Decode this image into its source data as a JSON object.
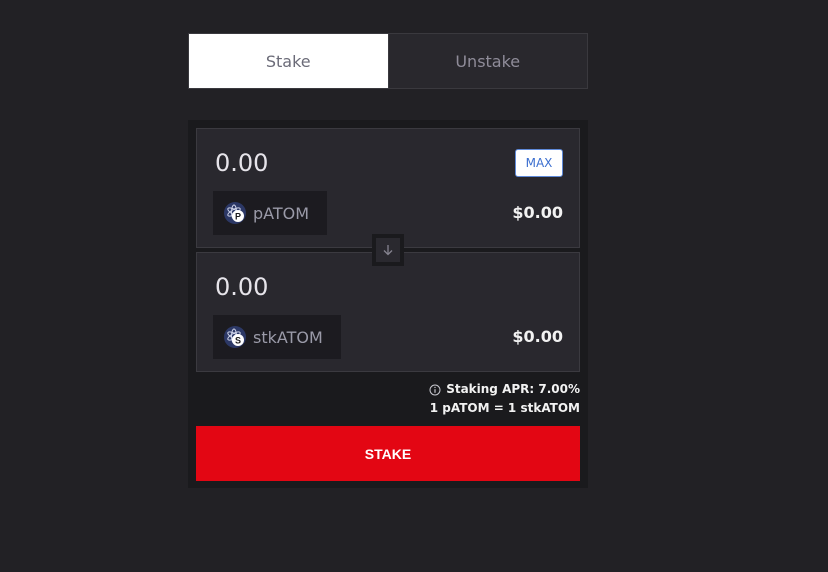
{
  "tabs": {
    "stake_label": "Stake",
    "unstake_label": "Unstake"
  },
  "from": {
    "amount": "0.00",
    "max_label": "MAX",
    "token": "pATOM",
    "token_badge": "P",
    "usd": "$0.00"
  },
  "to": {
    "amount": "0.00",
    "token": "stkATOM",
    "token_badge": "S",
    "usd": "$0.00"
  },
  "info": {
    "apr": "Staking APR: 7.00%",
    "rate": "1 pATOM = 1 stkATOM"
  },
  "action": {
    "label": "STAKE"
  },
  "icons": {
    "swap": "arrow-down-icon",
    "info": "info-icon"
  },
  "colors": {
    "accent": "#e30613",
    "max_border": "#5f8ad9"
  }
}
